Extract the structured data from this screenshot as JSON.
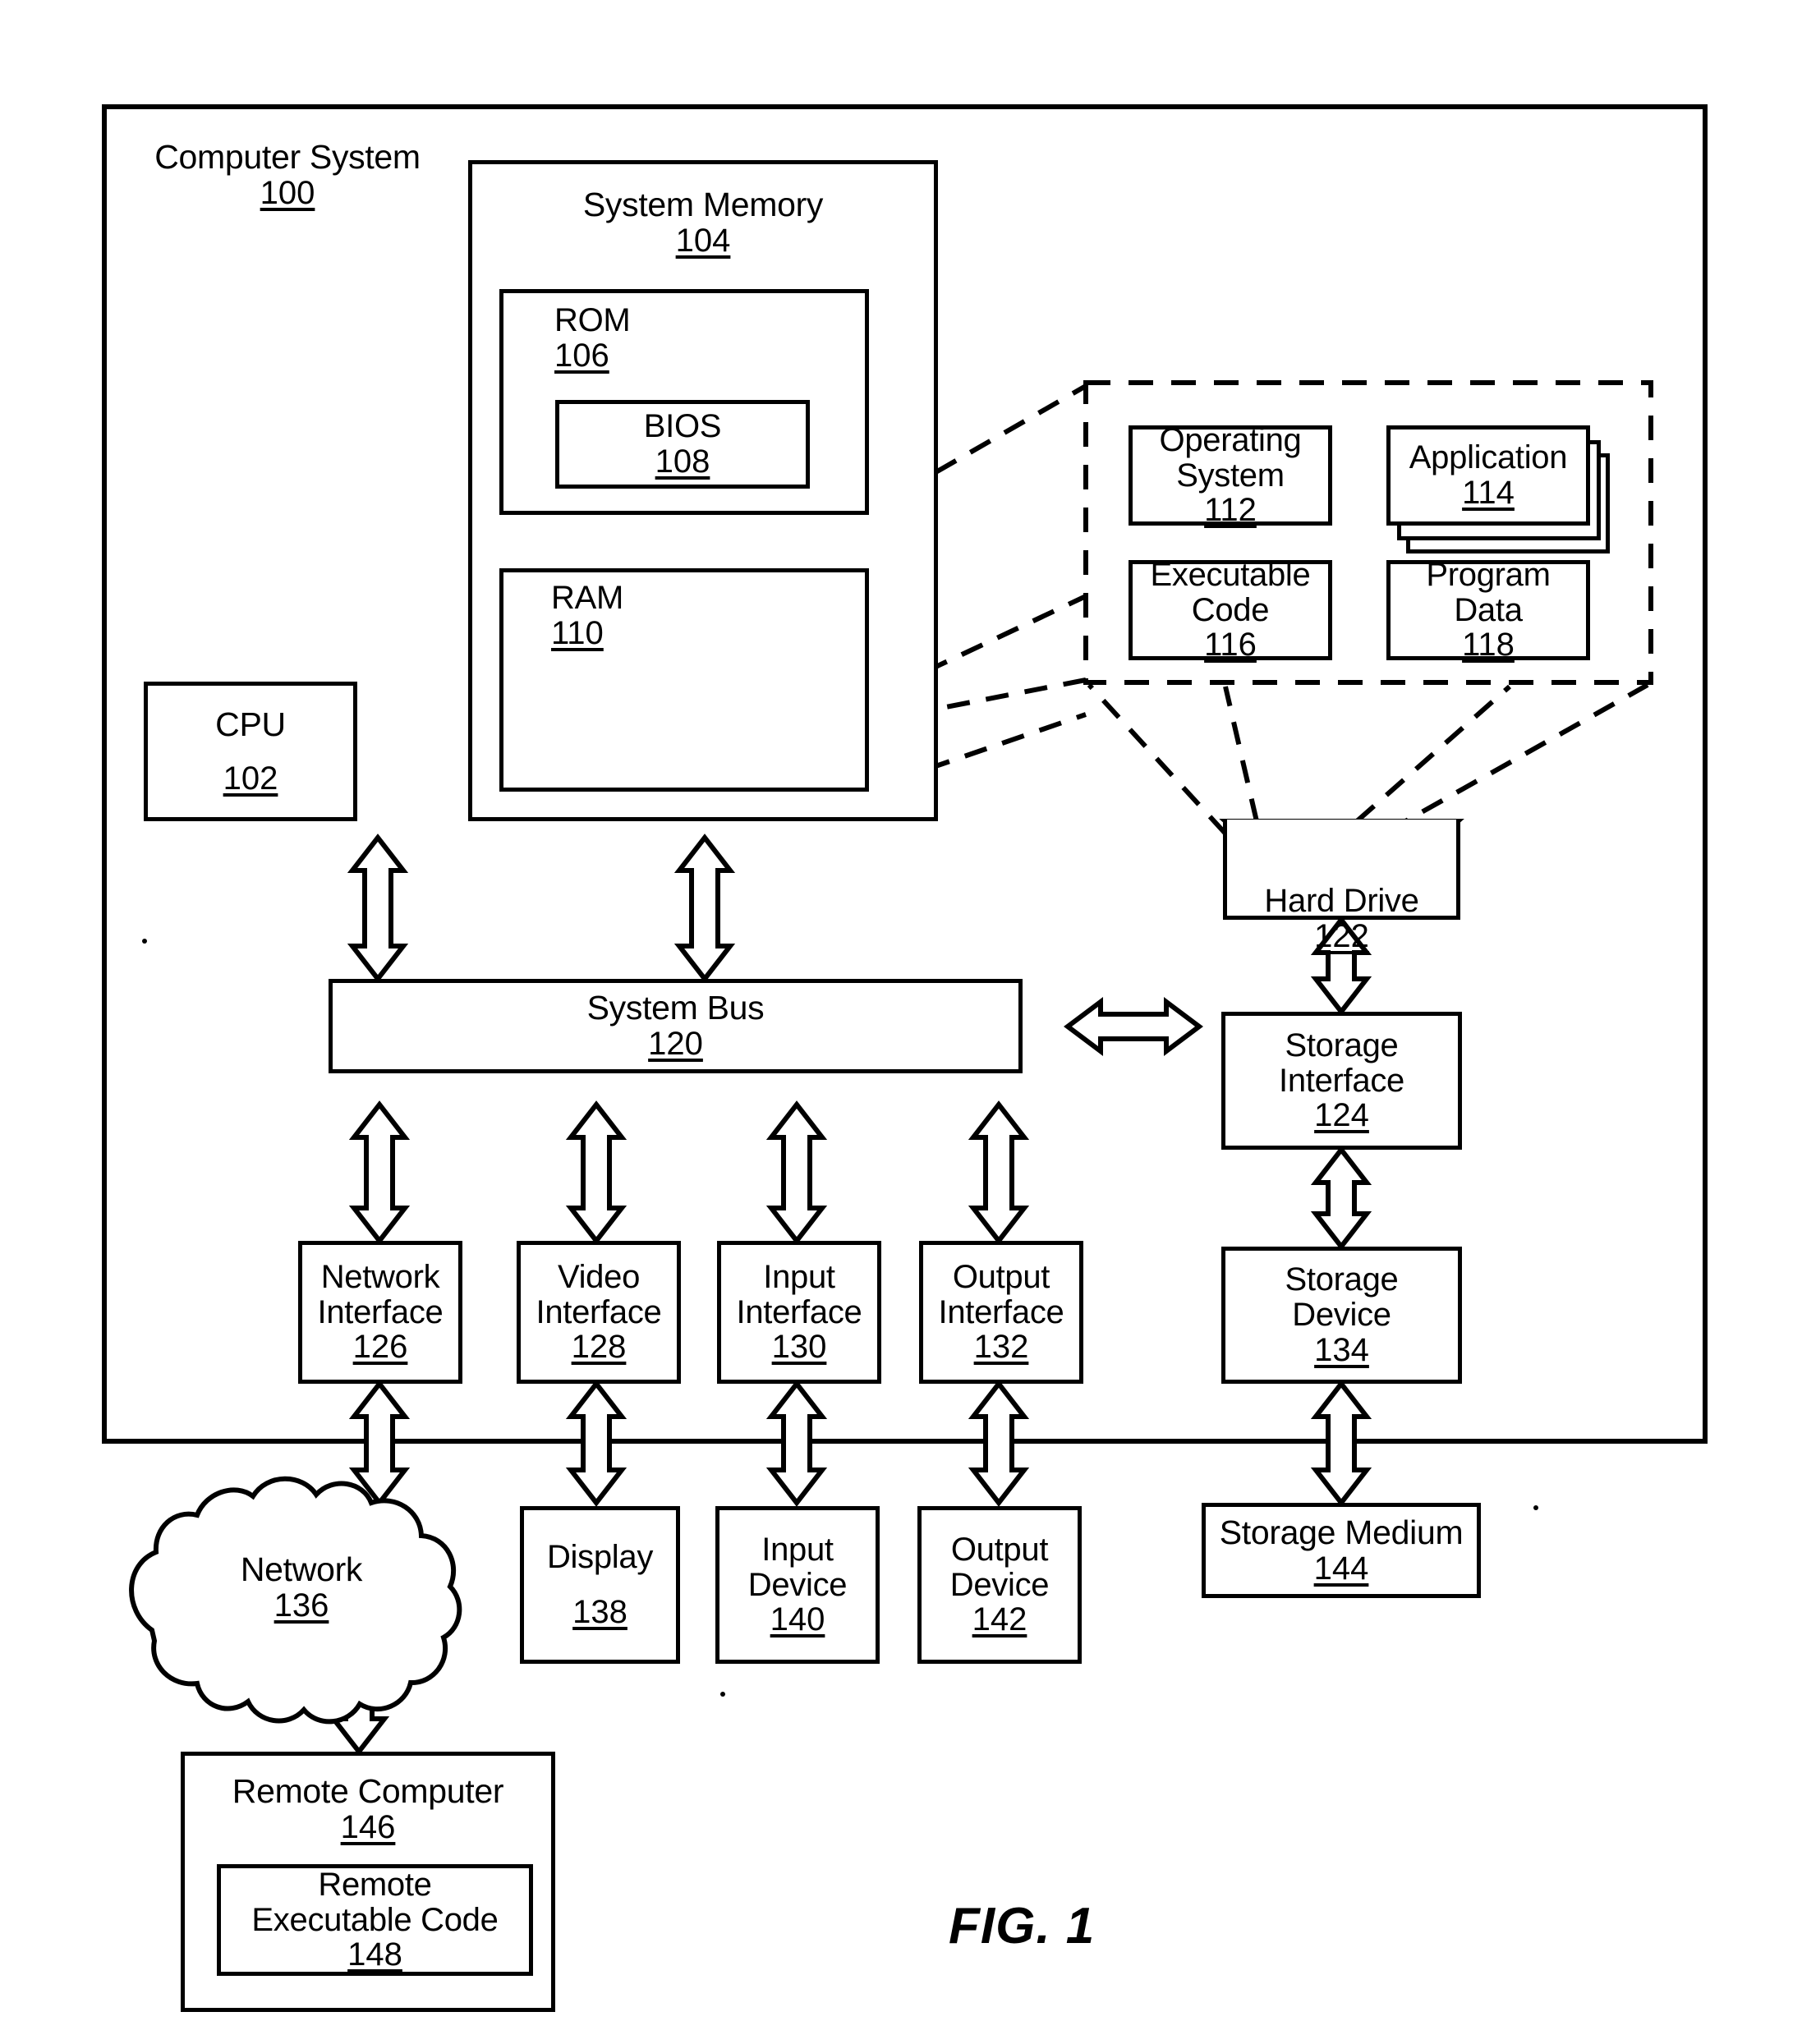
{
  "figure": {
    "caption": "FIG. 1",
    "outer": {
      "title": "Computer System",
      "number": "100"
    }
  },
  "blocks": {
    "system_memory": {
      "title": "System Memory",
      "number": "104"
    },
    "rom": {
      "title": "ROM",
      "number": "106"
    },
    "bios": {
      "title": "BIOS",
      "number": "108"
    },
    "ram": {
      "title": "RAM",
      "number": "110"
    },
    "cpu": {
      "title": "CPU",
      "number": "102"
    },
    "operating_system": {
      "title": "Operating\nSystem",
      "number": "112"
    },
    "application": {
      "title": "Application",
      "number": "114"
    },
    "executable_code": {
      "title": "Executable\nCode",
      "number": "116"
    },
    "program_data": {
      "title": "Program\nData",
      "number": "118"
    },
    "hard_drive": {
      "title": "Hard Drive",
      "number": "122"
    },
    "system_bus": {
      "title": "System Bus",
      "number": "120"
    },
    "storage_interface": {
      "title": "Storage\nInterface",
      "number": "124"
    },
    "network_interface": {
      "title": "Network\nInterface",
      "number": "126"
    },
    "video_interface": {
      "title": "Video\nInterface",
      "number": "128"
    },
    "input_interface": {
      "title": "Input\nInterface",
      "number": "130"
    },
    "output_interface": {
      "title": "Output\nInterface",
      "number": "132"
    },
    "storage_device": {
      "title": "Storage\nDevice",
      "number": "134"
    },
    "network": {
      "title": "Network",
      "number": "136"
    },
    "display": {
      "title": "Display",
      "number": "138"
    },
    "input_device": {
      "title": "Input\nDevice",
      "number": "140"
    },
    "output_device": {
      "title": "Output\nDevice",
      "number": "142"
    },
    "storage_medium": {
      "title": "Storage Medium",
      "number": "144"
    },
    "remote_computer": {
      "title": "Remote Computer",
      "number": "146"
    },
    "remote_executable_code": {
      "title": "Remote\nExecutable Code",
      "number": "148"
    }
  },
  "colors": {
    "line": "#000000",
    "background": "#ffffff"
  }
}
